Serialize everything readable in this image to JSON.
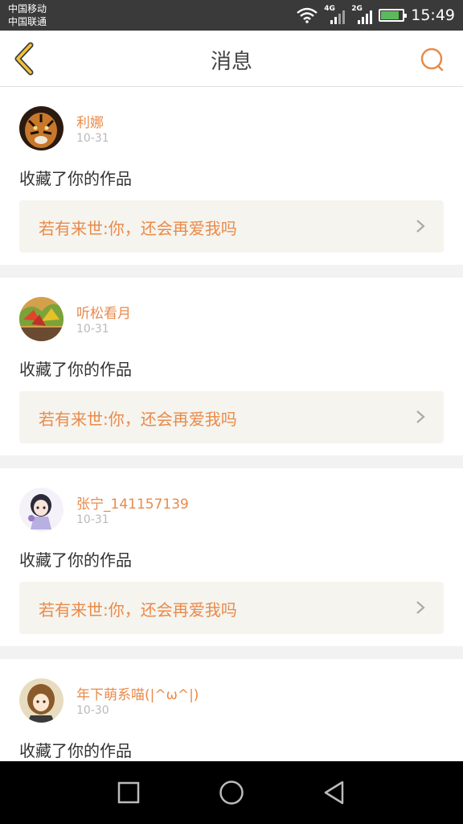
{
  "status": {
    "carrier1": "中国移动",
    "carrier2": "中国联通",
    "sig1": "4G",
    "sig2": "2G",
    "time": "15:49"
  },
  "header": {
    "title": "消息"
  },
  "messages": [
    {
      "name": "利娜",
      "date": "10-31",
      "action": "收藏了你的作品",
      "work": "若有来世:你，还会再爱我吗",
      "avatar_color": "#5a3a20"
    },
    {
      "name": "听松看月",
      "date": "10-31",
      "action": "收藏了你的作品",
      "work": "若有来世:你，还会再爱我吗",
      "avatar_color": "#c9702e"
    },
    {
      "name": "张宁_141157139",
      "date": "10-31",
      "action": "收藏了你的作品",
      "work": "若有来世:你，还会再爱我吗",
      "avatar_color": "#e8e6f2"
    },
    {
      "name": "年下萌系喵(|^ω^|)",
      "date": "10-30",
      "action": "收藏了你的作品",
      "work": "",
      "avatar_color": "#b98a4a"
    }
  ],
  "accent": "#e98a4a"
}
